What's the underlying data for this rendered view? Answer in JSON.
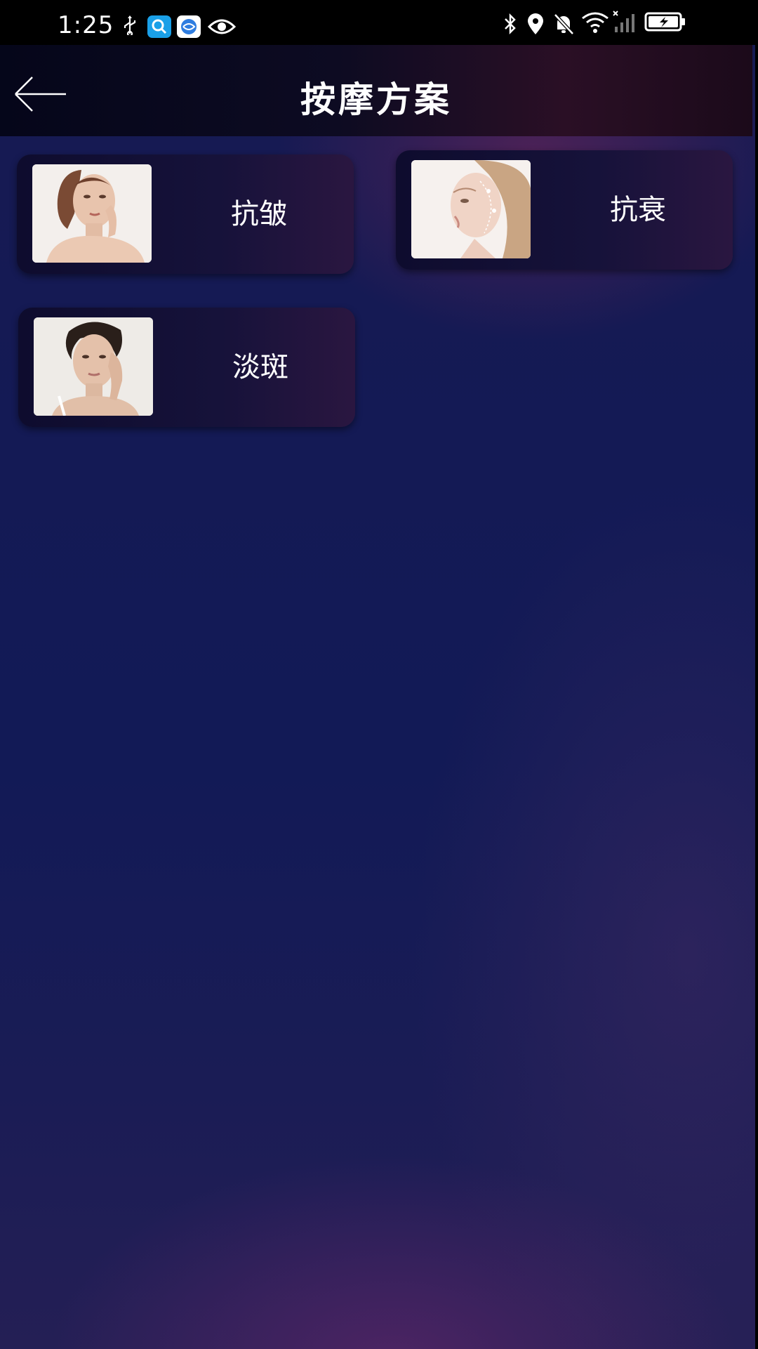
{
  "status_bar": {
    "time": "1:25",
    "icons": [
      "usb-icon",
      "search-app-icon",
      "browser-app-icon",
      "eye-icon",
      "bluetooth-icon",
      "location-icon",
      "bell-off-icon",
      "wifi-icon",
      "signal-icon",
      "battery-charging-icon"
    ]
  },
  "app_bar": {
    "back_icon": "arrow-left-icon",
    "title": "按摩方案"
  },
  "plans": [
    {
      "label": "抗皱",
      "image": "woman-touching-cheek-photo"
    },
    {
      "label": "抗衰",
      "image": "woman-face-lifting-lines-photo"
    },
    {
      "label": "淡斑",
      "image": "woman-hand-on-face-photo"
    }
  ],
  "colors": {
    "background_top": "#171a52",
    "background_bottom": "#241f55",
    "card": "#16123a",
    "text": "#ffffff"
  }
}
